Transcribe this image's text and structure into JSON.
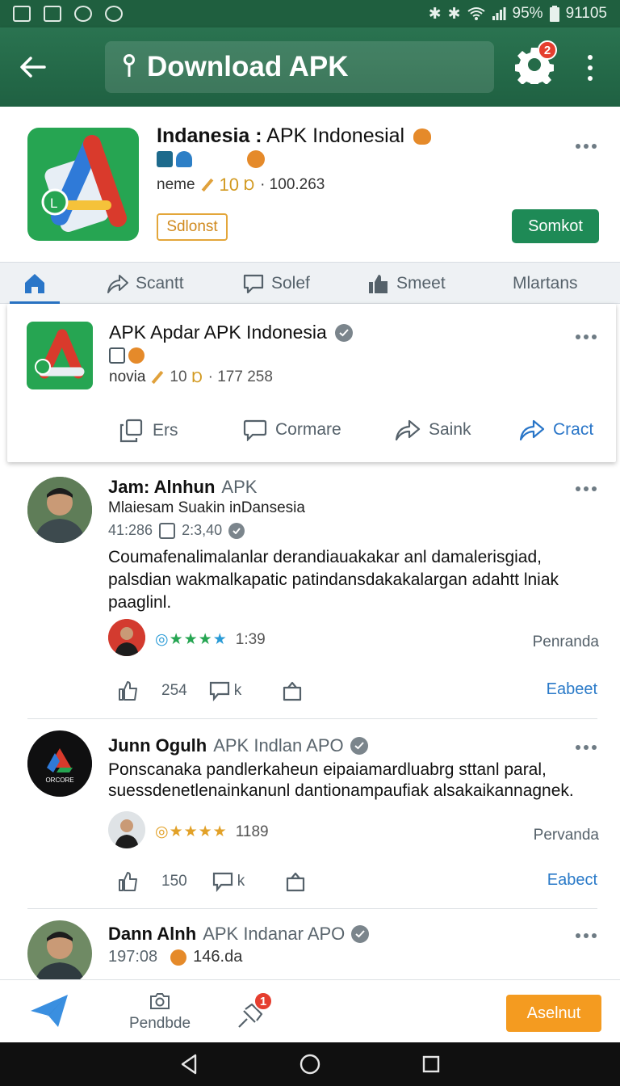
{
  "status_bar": {
    "battery": "95%",
    "time": "91105"
  },
  "app_bar": {
    "title": "Download APK",
    "notification_count": "2"
  },
  "app_header": {
    "title_bold": "Indanesia :",
    "title_rest": " APK Indonesial",
    "meta_label": "neme",
    "rating_num": "10",
    "downloads": "· 100.263",
    "outline_button": "Sdlonst",
    "primary_button": "Somkot"
  },
  "tabs": [
    {
      "label": ""
    },
    {
      "label": "Scantt"
    },
    {
      "label": "Solef"
    },
    {
      "label": "Smeet"
    },
    {
      "label": "Mlartans"
    }
  ],
  "feature_card": {
    "title": "APK Apdar APK Indonesia",
    "meta_label": "novia",
    "rating_num": "10",
    "downloads": "· 177 258",
    "actions": [
      "Ers",
      "Cormare",
      "Saink",
      "Cract"
    ]
  },
  "posts": [
    {
      "name": "Jam: Alnhun",
      "name_sub": "APK",
      "line": "Mlaiesam Suakin inDansesia",
      "meta_a": "41:286",
      "meta_b": "2:3,40",
      "body": "Coumafenalimalanlar derandiauakakar anl damalerisgiad, palsdian wakmalkapatic patindansdakakalargan adahtt lniak paaglinl.",
      "rating": "1:39",
      "side": "Penranda",
      "likes": "254",
      "comments": "k",
      "link": "Eabeet"
    },
    {
      "name": "Junn Ogulh",
      "name_sub": "APK Indlan APO",
      "logo_text": "ORCORE",
      "body": "Ponscanaka pandlerkaheun eipaiamardluabrg sttanl  paral, suessdenetlenainkanunl dantionampaufiak alsakaikannagnek.",
      "rating": "1189",
      "side": "Pervanda",
      "likes": "150",
      "comments": "k",
      "link": "Eabect"
    },
    {
      "name": "Dann Alnh",
      "name_sub": "APK Indanar APO",
      "meta_a": "197:08",
      "meta_b": "146.da"
    }
  ],
  "bottom_bar": {
    "middle_label": "Pendbde",
    "alert_count": "1",
    "action_button": "Aselnut"
  },
  "colors": {
    "primary_green": "#1f6142",
    "accent_blue": "#2a76c8",
    "orange": "#f49b20",
    "badge_red": "#e53e2f"
  }
}
